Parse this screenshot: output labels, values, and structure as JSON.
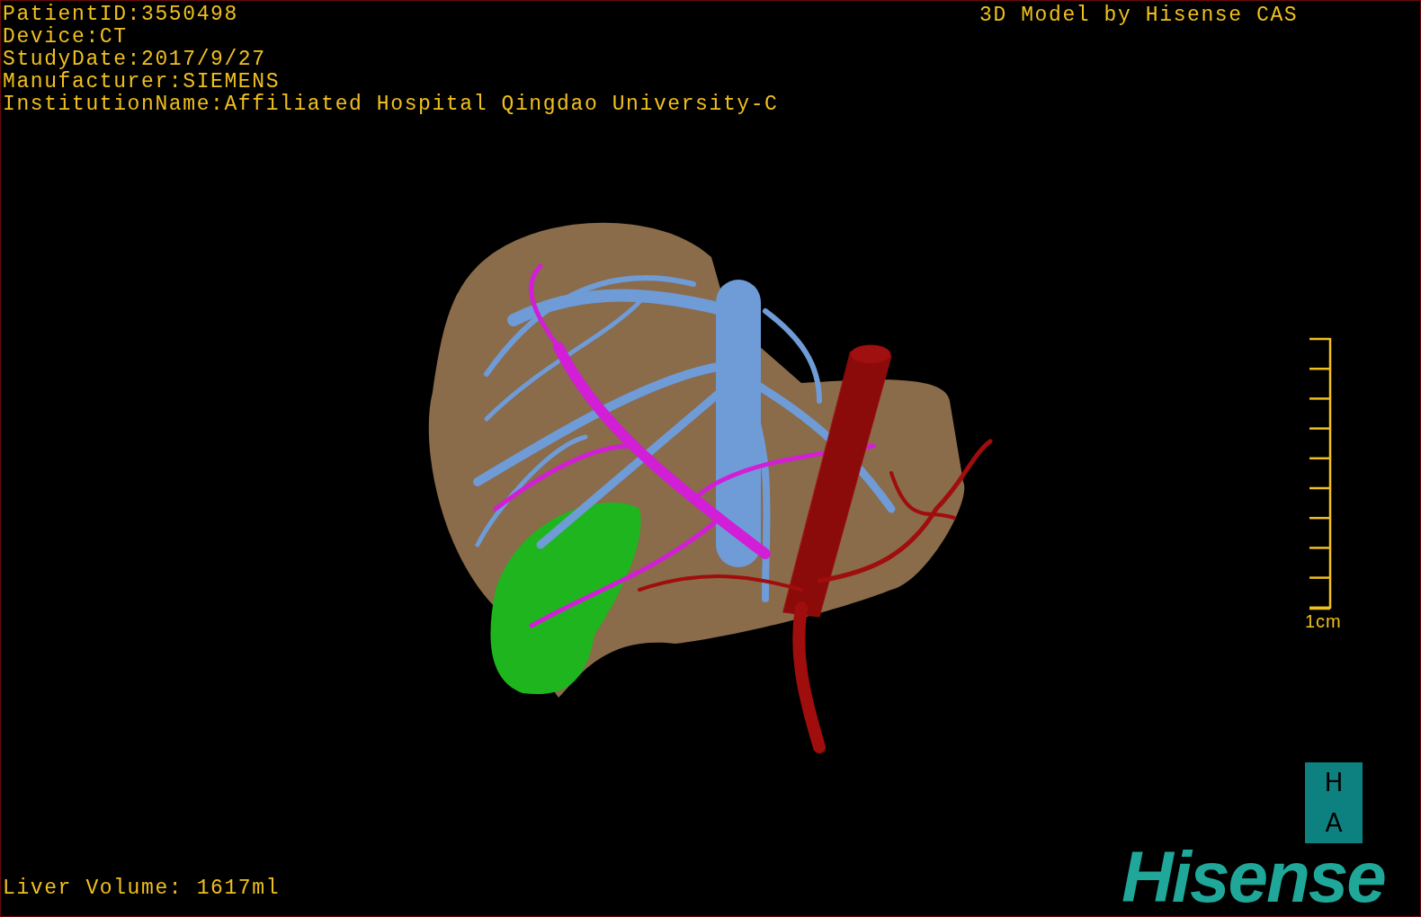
{
  "study_info": [
    "PatientID:3550498",
    "Device:CT",
    "StudyDate:2017/9/27",
    "Manufacturer:SIEMENS",
    "InstitutionName:Affiliated Hospital Qingdao University-C"
  ],
  "header_right": "3D Model by Hisense CAS",
  "scale_bar": {
    "label": "1cm"
  },
  "logo": {
    "badge_letters": [
      "H",
      "A"
    ],
    "wordmark": "Hisense"
  },
  "footer": "Liver Volume: 1617ml"
}
